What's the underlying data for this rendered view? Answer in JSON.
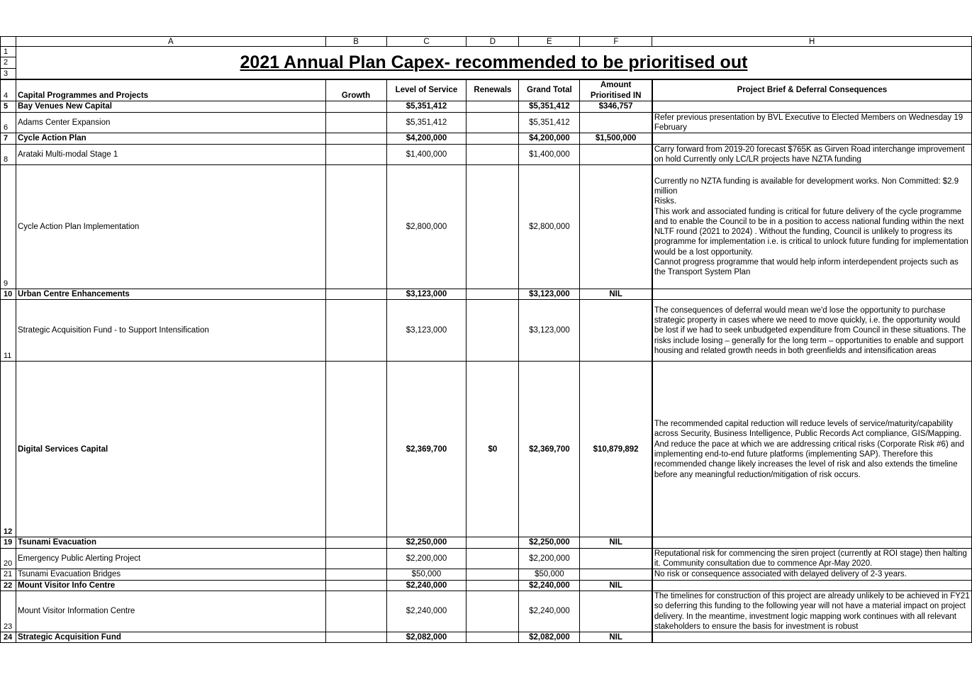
{
  "sheet": {
    "column_letters": [
      "A",
      "B",
      "C",
      "D",
      "E",
      "F",
      "H"
    ],
    "title_row_numbers": [
      "1",
      "2",
      "3"
    ],
    "title": "2021 Annual Plan Capex- recommended to be prioritised out",
    "header": {
      "row_number": "4",
      "project": "Capital Programmes and Projects",
      "growth": "Growth",
      "level_of_service": "Level of Service",
      "renewals": "Renewals",
      "grand_total": "Grand Total",
      "amount_prioritised_in": "Amount Prioritised IN",
      "brief": "Project Brief & Deferral Consequences"
    },
    "rows": [
      {
        "row": "5",
        "group": true,
        "project": "Bay Venues New Capital",
        "growth": "",
        "los": "$5,351,412",
        "renewals": "",
        "total": "$5,351,412",
        "prioritised": "$346,757",
        "brief": ""
      },
      {
        "row": "6",
        "group": false,
        "project": "Adams Center Expansion",
        "growth": "",
        "los": "$5,351,412",
        "renewals": "",
        "total": "$5,351,412",
        "prioritised": "",
        "brief": "Refer previous presentation by BVL Executive to Elected Members on Wednesday 19 February"
      },
      {
        "row": "7",
        "group": true,
        "project": "Cycle Action Plan",
        "growth": "",
        "los": "$4,200,000",
        "renewals": "",
        "total": "$4,200,000",
        "prioritised": "$1,500,000",
        "brief": ""
      },
      {
        "row": "8",
        "group": false,
        "project": "Arataki Multi-modal Stage 1",
        "growth": "",
        "los": "$1,400,000",
        "renewals": "",
        "total": "$1,400,000",
        "prioritised": "",
        "brief": "Carry forward from 2019-20  forecast $765K  as Girven Road interchange improvement on hold Currently only LC/LR projects have NZTA funding"
      },
      {
        "row": "9",
        "group": false,
        "project": "Cycle Action Plan Implementation",
        "growth": "",
        "los": "$2,800,000",
        "renewals": "",
        "total": "$2,800,000",
        "prioritised": "",
        "brief": "Currently no NZTA funding is available for development works. Non Committed: $2.9 million\nRisks.\nThis work and associated funding is critical for future delivery of the cycle programme and to enable the Council to be in a position to access national funding within the next NLTF round (2021 to 2024) . Without the funding, Council is unlikely to progress its programme for implementation i.e. is critical to unlock future funding for implementation would be a lost opportunity.\nCannot progress programme that would help inform interdependent projects such as the Transport System Plan"
      },
      {
        "row": "10",
        "group": true,
        "project": "Urban Centre Enhancements",
        "growth": "",
        "los": "$3,123,000",
        "renewals": "",
        "total": "$3,123,000",
        "prioritised": "NIL",
        "brief": ""
      },
      {
        "row": "11",
        "group": false,
        "project": "Strategic Acquisition Fund - to Support Intensification",
        "growth": "",
        "los": "$3,123,000",
        "renewals": "",
        "total": "$3,123,000",
        "prioritised": "",
        "brief": "The consequences of deferral would mean we'd lose the opportunity to purchase strategic property in cases where we need to move quickly, i.e. the opportunity would be lost if we had to seek unbudgeted expenditure from Council in these situations. The risks include losing – generally for the long term – opportunities to enable and support housing and related growth needs in both greenfields and intensification areas"
      },
      {
        "row": "12",
        "group": true,
        "project": "Digital Services Capital",
        "growth": "",
        "los": "$2,369,700",
        "renewals": "$0",
        "total": "$2,369,700",
        "prioritised": "$10,879,892",
        "brief": "The recommended capital reduction will reduce levels of service/maturity/capability across Security, Business Intelligence, Public Records Act compliance, GIS/Mapping.  And reduce the pace at which we are addressing critical risks (Corporate Risk #6) and implementing end-to-end future platforms (implementing SAP).  Therefore this recommended change likely increases the level of risk and also extends the timeline before any meaningful reduction/mitigation of risk occurs."
      },
      {
        "row": "19",
        "group": true,
        "project": "Tsunami Evacuation",
        "growth": "",
        "los": "$2,250,000",
        "renewals": "",
        "total": "$2,250,000",
        "prioritised": "NIL",
        "brief": ""
      },
      {
        "row": "20",
        "group": false,
        "project": "Emergency Public Alerting Project",
        "growth": "",
        "los": "$2,200,000",
        "renewals": "",
        "total": "$2,200,000",
        "prioritised": "",
        "brief": "Reputational risk for commencing the siren project (currently at ROI stage) then halting it. Community consultation due to commence Apr-May 2020."
      },
      {
        "row": "21",
        "group": false,
        "project": "Tsunami Evacuation Bridges",
        "growth": "",
        "los": "$50,000",
        "renewals": "",
        "total": "$50,000",
        "prioritised": "",
        "brief": "No risk or consequence associated with delayed delivery of 2-3 years."
      },
      {
        "row": "22",
        "group": true,
        "project": "Mount Visitor Info Centre",
        "growth": "",
        "los": "$2,240,000",
        "renewals": "",
        "total": "$2,240,000",
        "prioritised": "NIL",
        "brief": ""
      },
      {
        "row": "23",
        "group": false,
        "project": "Mount Visitor Information Centre",
        "growth": "",
        "los": "$2,240,000",
        "renewals": "",
        "total": "$2,240,000",
        "prioritised": "",
        "brief": "The timelines for construction of this project are already unlikely to be achieved in FY21 so deferring this funding to the following year will not have a material impact on project delivery. In the meantime, investment logic mapping work continues with all relevant stakeholders to ensure the basis for investment is robust"
      },
      {
        "row": "24",
        "group": true,
        "project": "Strategic Acquisition Fund",
        "growth": "",
        "los": "$2,082,000",
        "renewals": "",
        "total": "$2,082,000",
        "prioritised": "NIL",
        "brief": ""
      }
    ]
  }
}
